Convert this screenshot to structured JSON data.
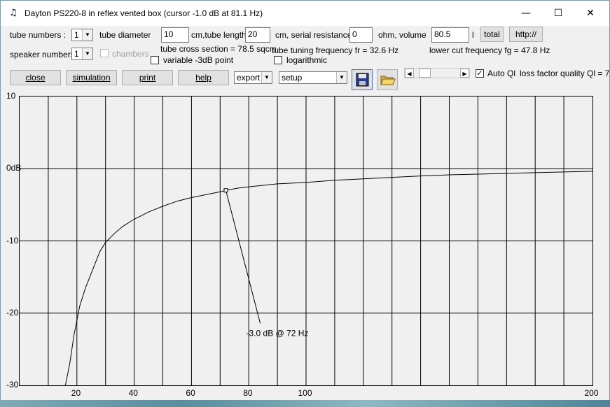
{
  "window": {
    "title": "Dayton PS220-8 in reflex vented box (cursor -1.0 dB at 81.1 Hz)",
    "app_icon": "app-icon",
    "min_glyph": "—",
    "max_glyph": "☐",
    "close_glyph": "✕"
  },
  "params": {
    "tube_numbers_label": "tube numbers :",
    "tube_numbers_value": "1",
    "tube_diameter_label": "tube diameter",
    "tube_diameter_value": "10",
    "tube_length_label": "cm,tube length",
    "tube_length_value": "20",
    "serial_resistance_label": "cm, serial resistance",
    "serial_resistance_value": "0",
    "volume_label": "ohm, volume",
    "volume_value": "80.5",
    "volume_unit": "l",
    "total_button": "total",
    "http_button": "http://",
    "speaker_numbers_label": "speaker numbers :",
    "speaker_numbers_value": "1",
    "chambers_label": "chambers",
    "tube_cross_section": "tube cross section = 78.5 sqcm",
    "tube_tuning_frequency": "tube tuning frequency fr = 32.6 Hz",
    "lower_cut_frequency": "lower cut frequency fg = 47.8 Hz",
    "variable_3db_label": "variable -3dB point",
    "logarithmic_label": "logarithmic"
  },
  "toolbar": {
    "close": "close",
    "simulation": "simulation",
    "print": "print",
    "help": "help",
    "export": "export",
    "setup": "setup",
    "auto_ql_label": "Auto Ql",
    "auto_ql_checked": true,
    "loss_factor_label": "loss factor quality Ql = 7"
  },
  "chart_data": {
    "type": "line",
    "xlim": [
      0,
      200
    ],
    "ylim": [
      -30,
      10
    ],
    "y_ticks": [
      {
        "value": 10,
        "label": "10"
      },
      {
        "value": 0,
        "label": "0dB"
      },
      {
        "value": -10,
        "label": "-10"
      },
      {
        "value": -20,
        "label": "-20"
      },
      {
        "value": -30,
        "label": "-30"
      }
    ],
    "x_ticks": [
      {
        "value": 20,
        "label": "20"
      },
      {
        "value": 40,
        "label": "40"
      },
      {
        "value": 60,
        "label": "60"
      },
      {
        "value": 80,
        "label": "80"
      },
      {
        "value": 100,
        "label": "100"
      },
      {
        "value": 200,
        "label": "200"
      }
    ],
    "x_gridlines": [
      10,
      20,
      30,
      40,
      50,
      60,
      70,
      80,
      90,
      100,
      110,
      120,
      130,
      140,
      150,
      160,
      170,
      180,
      190
    ],
    "y_gridlines": [
      0,
      -10,
      -20
    ],
    "grid": true,
    "series": [
      {
        "points": [
          [
            16,
            -30
          ],
          [
            17.5,
            -27
          ],
          [
            19,
            -23
          ],
          [
            21,
            -19
          ],
          [
            23,
            -16.5
          ],
          [
            26,
            -13.5
          ],
          [
            28,
            -11.5
          ],
          [
            30,
            -10.2
          ],
          [
            33,
            -9
          ],
          [
            36,
            -8
          ],
          [
            40,
            -7
          ],
          [
            45,
            -6
          ],
          [
            50,
            -5.2
          ],
          [
            55,
            -4.5
          ],
          [
            60,
            -4
          ],
          [
            65,
            -3.6
          ],
          [
            70,
            -3.2
          ],
          [
            72,
            -3.0
          ],
          [
            76,
            -2.7
          ],
          [
            80,
            -2.5
          ],
          [
            90,
            -2.1
          ],
          [
            100,
            -1.9
          ],
          [
            110,
            -1.6
          ],
          [
            120,
            -1.4
          ],
          [
            130,
            -1.2
          ],
          [
            140,
            -1.0
          ],
          [
            150,
            -0.85
          ],
          [
            160,
            -0.75
          ],
          [
            170,
            -0.65
          ],
          [
            180,
            -0.55
          ],
          [
            190,
            -0.45
          ],
          [
            200,
            -0.35
          ]
        ]
      }
    ],
    "marker": {
      "x": 72,
      "y": -3.0
    },
    "annotation": {
      "text": "-3.0 dB @ 72 Hz",
      "x": 84,
      "y": -22
    }
  }
}
